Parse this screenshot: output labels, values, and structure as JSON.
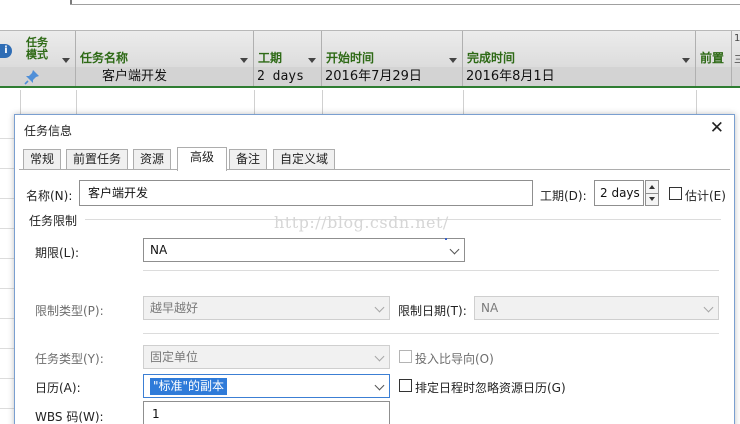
{
  "grid": {
    "headers": {
      "mode": "任务\n模式",
      "name": "任务名称",
      "duration": "工期",
      "start": "开始时间",
      "finish": "完成时间",
      "predecessors": "前置"
    },
    "right_cut_label": "1",
    "right_cut_label2": "三",
    "row": {
      "name": "客户端开发",
      "duration": "2 days",
      "start": "2016年7月29日",
      "finish": "2016年8月1日"
    }
  },
  "dialog": {
    "title": "任务信息",
    "close_glyph": "✕",
    "tabs": [
      "常规",
      "前置任务",
      "资源",
      "高级",
      "备注",
      "自定义域"
    ],
    "active_tab": "高级",
    "name_label": "名称(N):",
    "name_value": "客户端开发",
    "duration_label": "工期(D):",
    "duration_value": "2 days",
    "estimated_label": "估计(E)",
    "constraint_group": "任务限制",
    "deadline_label": "期限(L):",
    "deadline_value": "NA",
    "constraint_type_label": "限制类型(P):",
    "constraint_type_value": "越早越好",
    "constraint_date_label": "限制日期(T):",
    "constraint_date_value": "NA",
    "task_type_label": "任务类型(Y):",
    "task_type_value": "固定单位",
    "effort_driven_label": "投入比导向(O)",
    "calendar_label": "日历(A):",
    "calendar_value": "\"标准\"的副本",
    "ignore_resource_calendar_label": "排定日程时忽略资源日历(G)",
    "wbs_label": "WBS 码(W):",
    "wbs_value": "1"
  },
  "watermark": "http://blog.csdn.net/",
  "colors": {
    "header_text": "#2e6a16",
    "row_highlight": "#d3d3d3",
    "selection": "#2f7bd9",
    "accent_border": "#2e7d32"
  }
}
